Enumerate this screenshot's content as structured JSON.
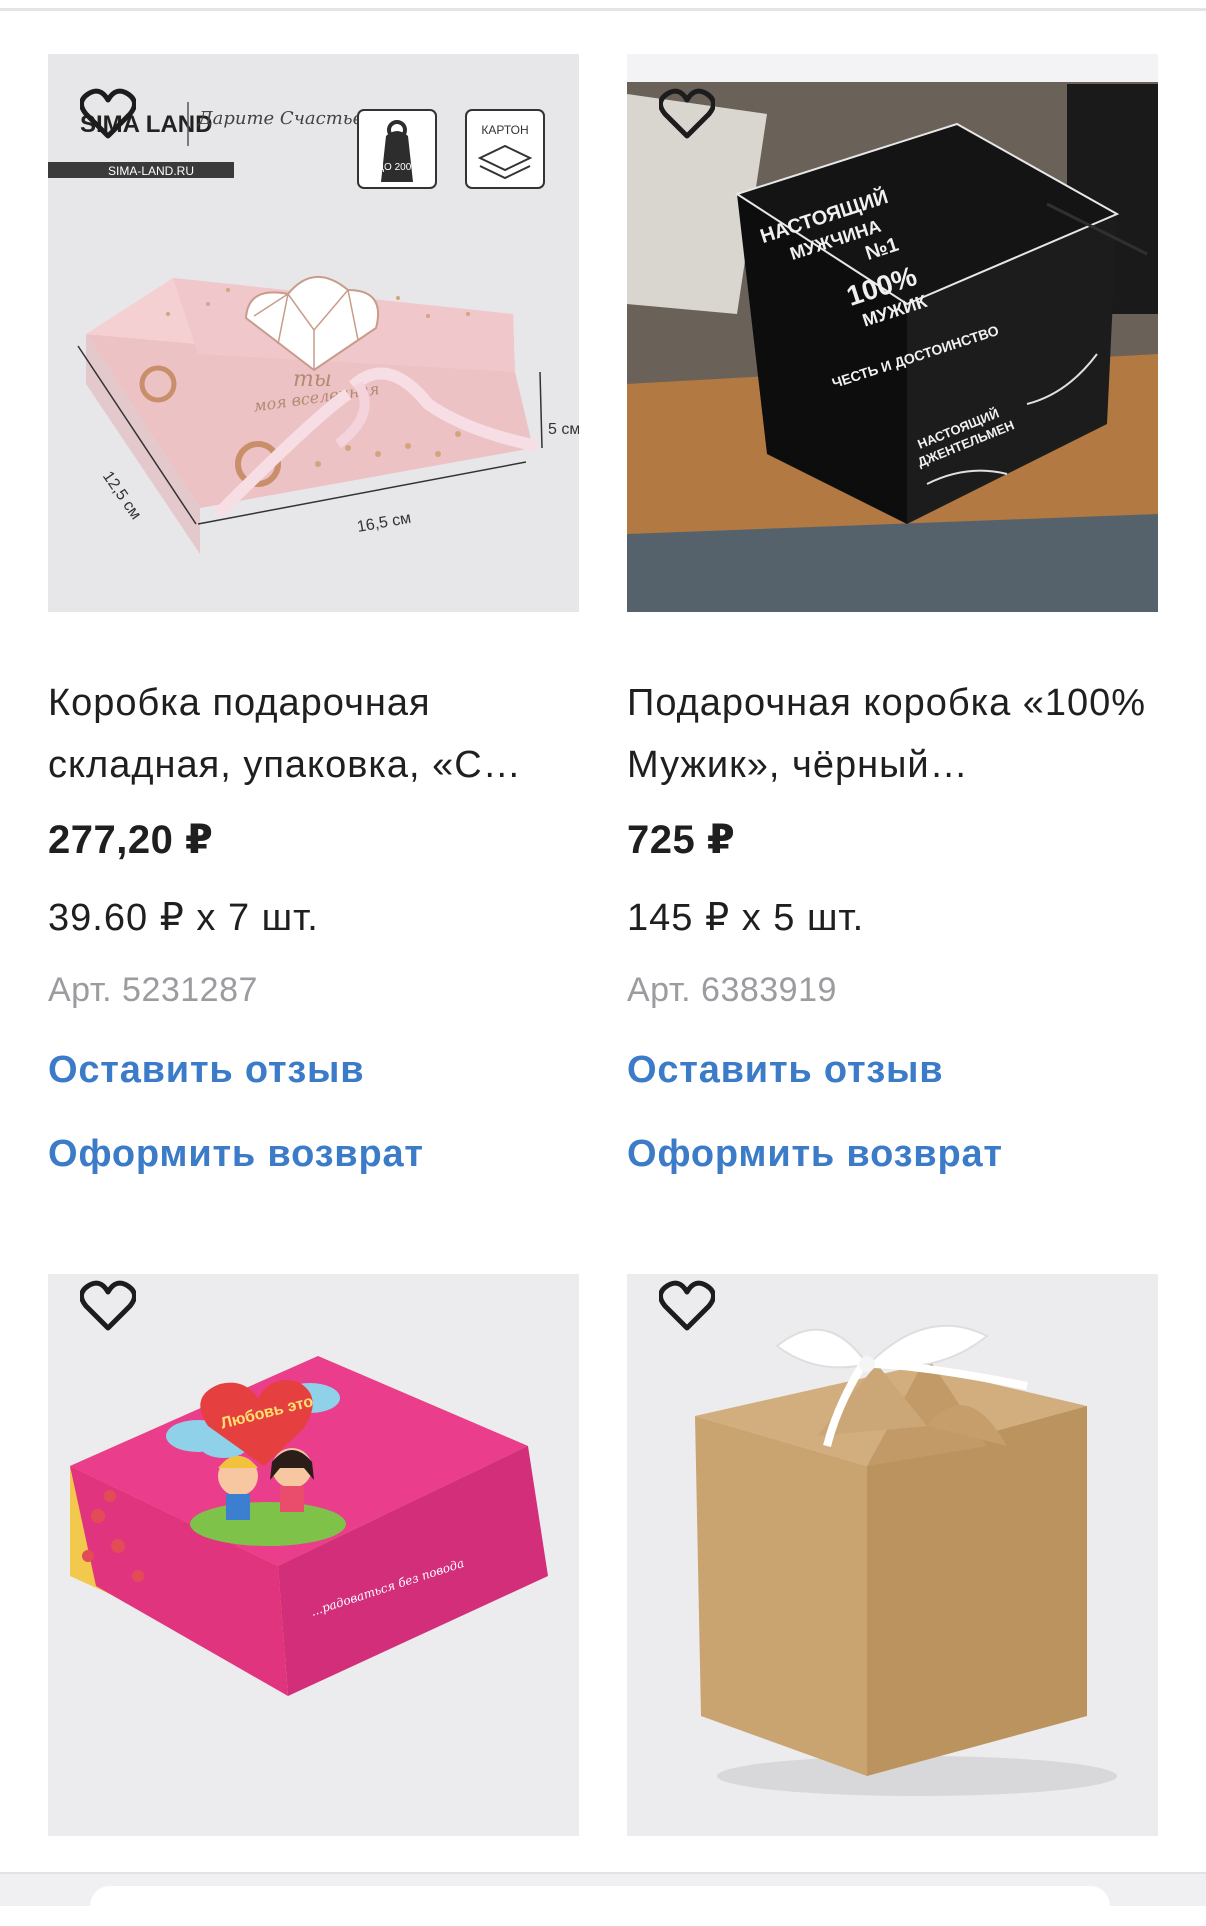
{
  "products": [
    {
      "title": "Коробка подарочная складная, упаковка, «С…",
      "price": "277,20 ₽",
      "unit_price": "39.60 ₽ x 7 шт.",
      "sku": "Арт. 5231287",
      "review_link": "Оставить отзыв",
      "return_link": "Оформить возврат",
      "image": {
        "brand": "SIMA LAND",
        "brand_tagline": "Дарите Счастье",
        "brand_url": "SIMA-LAND.RU",
        "weight_badge": "ДО 200Г",
        "material_badge": "КАРТОН",
        "box_text_1": "ты",
        "box_text_2": "моя вселенная",
        "dim_height": "5 см",
        "dim_width": "12,5 см",
        "dim_length": "16,5 см"
      }
    },
    {
      "title": "Подарочная коробка «100% Мужик», чёрный…",
      "price": "725 ₽",
      "unit_price": "145 ₽ x 5 шт.",
      "sku": "Арт. 6383919",
      "review_link": "Оставить отзыв",
      "return_link": "Оформить возврат",
      "image": {
        "line_1": "НАСТОЯЩИЙ",
        "line_2": "МУЖЧИНА",
        "line_3": "№1",
        "line_4": "100%",
        "line_5": "МУЖИК",
        "line_6": "ЧЕСТЬ И ДОСТОИНСТВО",
        "side_1": "НАСТОЯЩИЙ",
        "side_2": "ДЖЕНТЕЛЬМЕН"
      }
    },
    {
      "image": {
        "box_text": "Любовь это",
        "box_caption": "...радоваться без повода"
      }
    },
    {
      "image": {}
    }
  ],
  "colors": {
    "link": "#3b7bc8",
    "sku": "#9b9ba0",
    "text": "#1f1f1f",
    "image_bg": "#f3f3f5"
  }
}
